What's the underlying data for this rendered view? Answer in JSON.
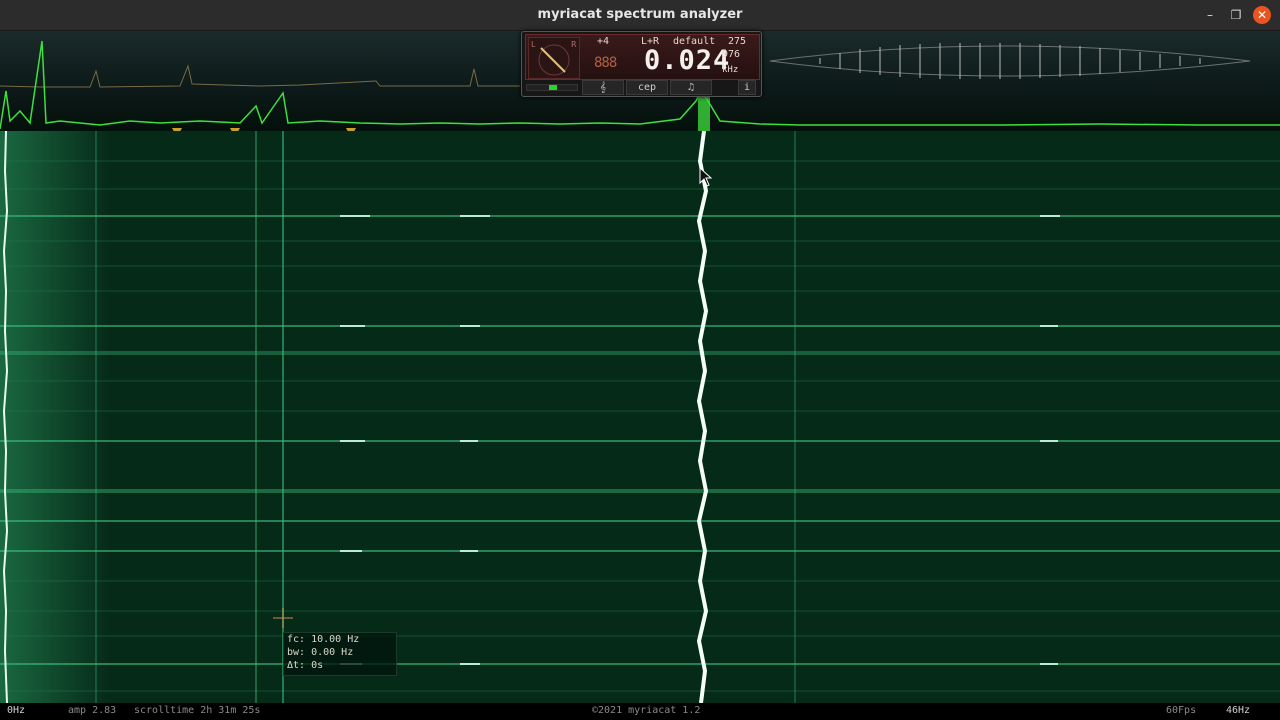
{
  "window": {
    "title": "myriacat spectrum analyzer",
    "buttons": {
      "minimize": "–",
      "maximize": "❐",
      "close": "✕"
    }
  },
  "panel": {
    "plus4": "+4",
    "channel": "L+R",
    "preset": "default",
    "value_275": "275",
    "segment_digits": "888",
    "frequency": "0.024",
    "sub_value": "976",
    "unit": "kHz",
    "buttons": {
      "note": "𝄞",
      "cep": "cep",
      "tune": "♫",
      "info": "i"
    },
    "colors": {
      "display_bg": "#2d1313",
      "level": "#2bd42b"
    }
  },
  "readout": {
    "fc": "fc: 10.00 Hz",
    "bw": "bw: 0.00 Hz",
    "dt": "Δt: 0s"
  },
  "status": {
    "left_freq": "0Hz",
    "amp": "amp 2.83",
    "scrolltime": "scrolltime 2h 31m 25s",
    "copyright": "©2021 myriacat 1.2",
    "fps": "60Fps",
    "right_freq": "46Hz"
  },
  "colors": {
    "waterfall_bg": "#062a18",
    "spectrum_line": "#3ee03e",
    "marker": "#c8a030",
    "accent_close": "#e95420"
  }
}
